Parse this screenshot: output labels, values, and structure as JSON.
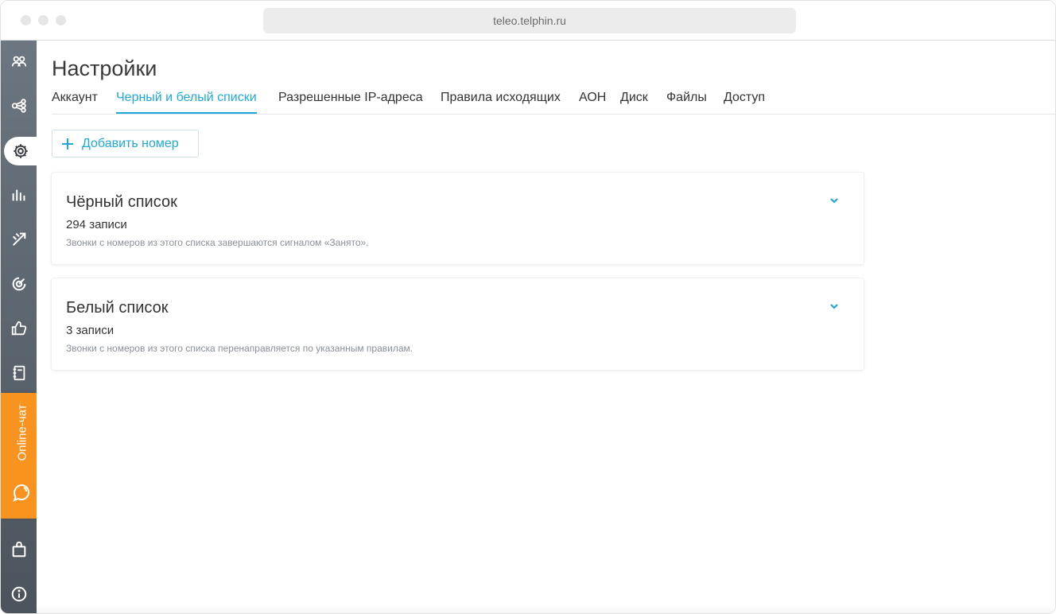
{
  "browser": {
    "url": "teleo.telphin.ru"
  },
  "sidebar": {
    "items": [
      {
        "icon": "users-icon"
      },
      {
        "icon": "scheme-icon"
      },
      {
        "icon": "settings-icon",
        "active": true
      },
      {
        "icon": "stats-icon"
      },
      {
        "icon": "calls-icon"
      },
      {
        "icon": "target-icon"
      },
      {
        "icon": "thumbs-up-icon"
      },
      {
        "icon": "notebook-icon"
      },
      {
        "icon": "bag-icon"
      },
      {
        "icon": "info-icon"
      }
    ],
    "online_chat_label": "Online-чат"
  },
  "page": {
    "title": "Настройки"
  },
  "tabs": [
    {
      "label": "Аккаунт"
    },
    {
      "label": "Черный и белый списки",
      "active": true
    },
    {
      "label": "Разрешенные IP-адреса"
    },
    {
      "label": "Правила исходящих"
    },
    {
      "label": "АОН"
    },
    {
      "label": "Диск"
    },
    {
      "label": "Файлы"
    },
    {
      "label": "Доступ"
    }
  ],
  "toolbar": {
    "add_number_label": "Добавить номер"
  },
  "lists": [
    {
      "title": "Чёрный список",
      "count": "294 записи",
      "description": "Звонки с номеров из этого списка завершаются сигналом «Занято»."
    },
    {
      "title": "Белый список",
      "count": "3 записи",
      "description": "Звонки с номеров из этого списка перенаправляется по указанным правилам."
    }
  ],
  "colors": {
    "accent": "#1fa9d8",
    "sidebar": "#5a646e",
    "online_chat": "#f7931e"
  }
}
